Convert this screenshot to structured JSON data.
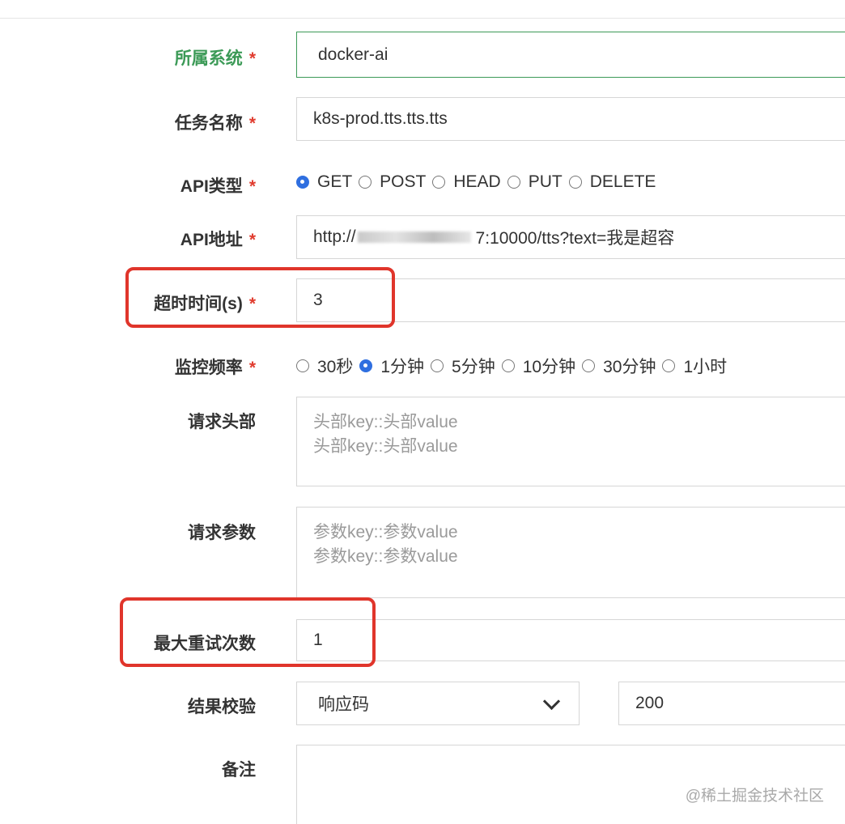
{
  "form": {
    "system": {
      "label": "所属系统",
      "required": "*",
      "value": "docker-ai"
    },
    "task_name": {
      "label": "任务名称",
      "required": "*",
      "value": "k8s-prod.tts.tts.tts"
    },
    "api_type": {
      "label": "API类型",
      "required": "*",
      "options": [
        "GET",
        "POST",
        "HEAD",
        "PUT",
        "DELETE"
      ],
      "selected": "GET"
    },
    "api_url": {
      "label": "API地址",
      "required": "*",
      "value_prefix": "http://",
      "value_suffix": "7:10000/tts?text=我是超容"
    },
    "timeout": {
      "label": "超时时间(s)",
      "required": "*",
      "value": "3"
    },
    "frequency": {
      "label": "监控频率",
      "required": "*",
      "options": [
        "30秒",
        "1分钟",
        "5分钟",
        "10分钟",
        "30分钟",
        "1小时"
      ],
      "selected": "1分钟"
    },
    "headers": {
      "label": "请求头部",
      "placeholder": "头部key::头部value\n头部key::头部value"
    },
    "params": {
      "label": "请求参数",
      "placeholder": "参数key::参数value\n参数key::参数value"
    },
    "max_retry": {
      "label": "最大重试次数",
      "value": "1"
    },
    "result_check": {
      "label": "结果校验",
      "select_value": "响应码",
      "value": "200"
    },
    "remark": {
      "label": "备注",
      "value": ""
    }
  },
  "watermark": "@稀土掘金技术社区",
  "colors": {
    "active_label": "#3c9a57",
    "required": "#e03c2f",
    "radio_checked": "#2f6fe0",
    "highlight": "#e0352b"
  }
}
